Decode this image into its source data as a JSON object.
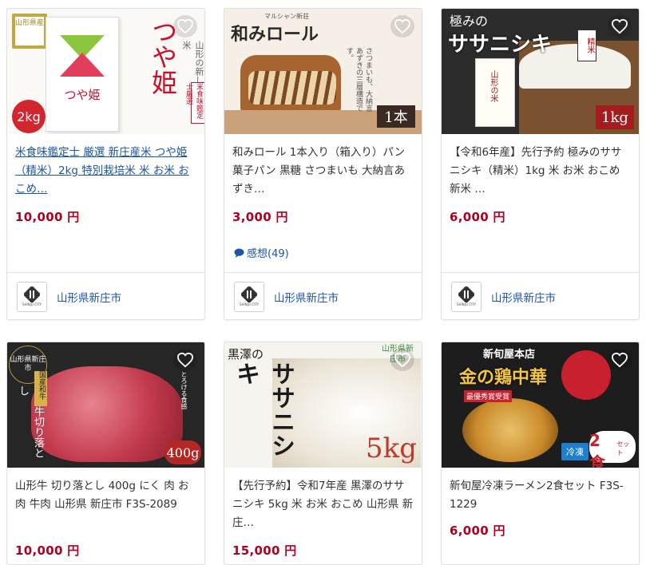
{
  "products": [
    {
      "title": "米食味鑑定士 厳選 新庄産米 つや姫（精米）2kg 特別栽培米 米 お米 おこめ…",
      "price": "10,000 円",
      "seller": "山形県新庄市",
      "img": {
        "brand": "つや姫",
        "badge": "2kg",
        "corner": "山形県産",
        "side": "山形の新しいお米",
        "bag_label": "つや姫",
        "stamp": "米食味鑑定士厳選"
      }
    },
    {
      "title": "和みロール 1本入り（箱入り）パン 菓子パン 黒糖 さつまいも 大納言あずき…",
      "price": "3,000 円",
      "review": "感想(49)",
      "seller": "山形県新庄市",
      "img": {
        "brand": "和みロール",
        "tag": "マルシャン新荘",
        "badge": "1本",
        "desc": "さつまいも、大納言あずきの三層構造です。"
      }
    },
    {
      "title": "【令和6年産】先行予約 極みのササニシキ（精米）1kg 米 お米 おこめ 新米 …",
      "price": "6,000 円",
      "seller": "山形県新庄市",
      "img": {
        "brand_top": "極みの",
        "brand": "ササニシキ",
        "tag": "精米",
        "badge": "1kg",
        "bag_label": "山形の米"
      }
    },
    {
      "title": "山形牛 切り落とし 400g にく 肉 お肉 牛肉 山形県 新庄市 F3S-2089",
      "price": "10,000 円",
      "img": {
        "circle": "山形県新庄市",
        "brand": "山形牛切り落とし",
        "tag": "国産和牛",
        "badge": "400g",
        "side": "とろける食感"
      }
    },
    {
      "title": "【先行予約】令和7年産 黒澤のササニシキ 5kg 米 お米 おこめ 山形県 新庄…",
      "price": "15,000 円",
      "img": {
        "brand_top": "黒澤の",
        "brand": "ササニシキ",
        "badge": "5kg",
        "corner": "山形県新庄市"
      }
    },
    {
      "title": "新旬屋冷凍ラーメン2食セット F3S-1229",
      "price": "6,000 円",
      "img": {
        "shop": "新旬屋本店",
        "brand": "金の鶏中華",
        "award": "最優秀賞受賞",
        "badge": "2食",
        "badge_sub": "セット",
        "tag": "冷凍"
      }
    }
  ],
  "seller_logo_text": "SHINJO CITY",
  "colors": {
    "price": "#b00020",
    "link": "#1a55a7"
  }
}
